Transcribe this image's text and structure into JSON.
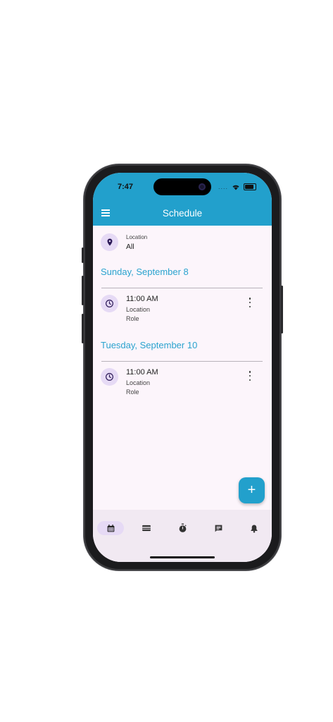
{
  "status": {
    "time": "7:47",
    "signal_dots": "...."
  },
  "appbar": {
    "title": "Schedule"
  },
  "location": {
    "label": "Location",
    "value": "All"
  },
  "schedule": [
    {
      "date": "Sunday, September 8",
      "events": [
        {
          "time": "11:00 AM",
          "location": "Location",
          "role": "Role"
        }
      ]
    },
    {
      "date": "Tuesday, September 10",
      "events": [
        {
          "time": "11:00 AM",
          "location": "Location",
          "role": "Role"
        }
      ]
    }
  ],
  "fab": {
    "label": "+"
  },
  "colors": {
    "primary": "#22a0cc",
    "background": "#fcf5fb",
    "icon_bg": "#e6daf5",
    "icon": "#2d1a59"
  },
  "nav": [
    {
      "icon": "calendar-icon",
      "active": true
    },
    {
      "icon": "card-icon",
      "active": false
    },
    {
      "icon": "stopwatch-icon",
      "active": false
    },
    {
      "icon": "message-icon",
      "active": false
    },
    {
      "icon": "bell-icon",
      "active": false
    }
  ]
}
